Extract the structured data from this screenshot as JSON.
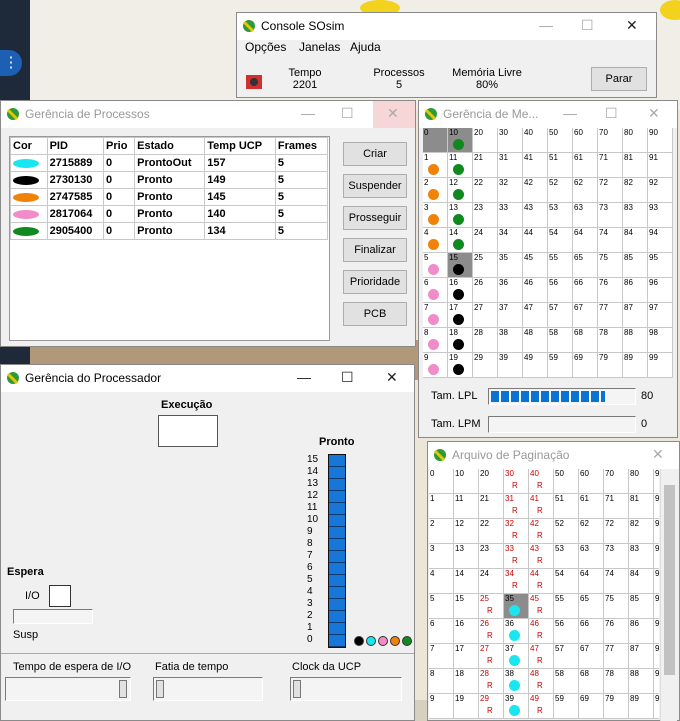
{
  "console": {
    "title": "Console SOsim",
    "menu": [
      "Opções",
      "Janelas",
      "Ajuda"
    ],
    "stats": [
      {
        "label": "Tempo",
        "value": "2201"
      },
      {
        "label": "Processos",
        "value": "5"
      },
      {
        "label": "Memória Livre",
        "value": "80%"
      }
    ],
    "stop_label": "Parar"
  },
  "processes": {
    "title": "Gerência de Processos",
    "columns": [
      "Cor",
      "PID",
      "Prio",
      "Estado",
      "Temp UCP",
      "Frames"
    ],
    "rows": [
      {
        "color": "#18e6f0",
        "pid": "2715889",
        "prio": "0",
        "state": "ProntoOut",
        "cpu": "157",
        "frames": "5"
      },
      {
        "color": "#000000",
        "pid": "2730130",
        "prio": "0",
        "state": "Pronto",
        "cpu": "149",
        "frames": "5"
      },
      {
        "color": "#f0820a",
        "pid": "2747585",
        "prio": "0",
        "state": "Pronto",
        "cpu": "145",
        "frames": "5"
      },
      {
        "color": "#f08cc8",
        "pid": "2817064",
        "prio": "0",
        "state": "Pronto",
        "cpu": "140",
        "frames": "5"
      },
      {
        "color": "#0f8a1e",
        "pid": "2905400",
        "prio": "0",
        "state": "Pronto",
        "cpu": "134",
        "frames": "5"
      }
    ],
    "buttons": [
      "Criar",
      "Suspender",
      "Prosseguir",
      "Finalizar",
      "Prioridade",
      "PCB"
    ]
  },
  "memory": {
    "title": "Gerência de Me...",
    "lpl_label": "Tam. LPL",
    "lpl_value": "80",
    "lpl_fill": 0.8,
    "lpm_label": "Tam. LPM",
    "lpm_value": "0",
    "col0": [
      "0",
      "1",
      "2",
      "3",
      "4",
      "5",
      "6",
      "7",
      "8",
      "9"
    ],
    "col0_colors": [
      "gray",
      "orange",
      "orange",
      "orange",
      "orange",
      "pink",
      "pink",
      "pink",
      "pink",
      "pink"
    ],
    "col1": [
      "10",
      "11",
      "12",
      "13",
      "14",
      "15",
      "16",
      "17",
      "18",
      "19"
    ],
    "col1_colors": [
      "green",
      "green",
      "green",
      "green",
      "green",
      "black",
      "black",
      "black",
      "black",
      "black"
    ],
    "cols": [
      [
        "20",
        "21",
        "22",
        "23",
        "24",
        "25",
        "26",
        "27",
        "28",
        "29"
      ],
      [
        "30",
        "31",
        "32",
        "33",
        "34",
        "35",
        "36",
        "37",
        "38",
        "39"
      ],
      [
        "40",
        "41",
        "42",
        "43",
        "44",
        "45",
        "46",
        "47",
        "48",
        "49"
      ],
      [
        "50",
        "51",
        "52",
        "53",
        "54",
        "55",
        "56",
        "57",
        "58",
        "59"
      ],
      [
        "60",
        "61",
        "62",
        "63",
        "64",
        "65",
        "66",
        "67",
        "68",
        "69"
      ],
      [
        "70",
        "71",
        "72",
        "73",
        "74",
        "75",
        "76",
        "77",
        "78",
        "79"
      ],
      [
        "80",
        "81",
        "82",
        "83",
        "84",
        "85",
        "86",
        "87",
        "88",
        "89"
      ],
      [
        "90",
        "91",
        "92",
        "93",
        "94",
        "95",
        "96",
        "97",
        "98",
        "99"
      ]
    ]
  },
  "paging": {
    "title": "Arquivo de Paginação",
    "cols": [
      [
        "0",
        "1",
        "2",
        "3",
        "4",
        "5",
        "6",
        "7",
        "8",
        "9"
      ],
      [
        "10",
        "11",
        "12",
        "13",
        "14",
        "15",
        "16",
        "17",
        "18",
        "19"
      ],
      [
        "20",
        "21",
        "22",
        "23",
        "24",
        "25",
        "26",
        "27",
        "28",
        "29"
      ],
      [
        "30",
        "31",
        "32",
        "33",
        "34",
        "35",
        "36",
        "37",
        "38",
        "39"
      ],
      [
        "40",
        "41",
        "42",
        "43",
        "44",
        "45",
        "46",
        "47",
        "48",
        "49"
      ],
      [
        "50",
        "51",
        "52",
        "53",
        "54",
        "55",
        "56",
        "57",
        "58",
        "59"
      ],
      [
        "60",
        "61",
        "62",
        "63",
        "64",
        "65",
        "66",
        "67",
        "68",
        "69"
      ],
      [
        "70",
        "71",
        "72",
        "73",
        "74",
        "75",
        "76",
        "77",
        "78",
        "79"
      ],
      [
        "80",
        "81",
        "82",
        "83",
        "84",
        "85",
        "86",
        "87",
        "88",
        "89"
      ],
      [
        "9",
        "9",
        "9",
        "9",
        "9",
        "9",
        "9",
        "9",
        "9",
        "9"
      ]
    ],
    "r_mark": "R"
  },
  "processor": {
    "title": "Gerência do Processador",
    "exec_label": "Execução",
    "ready_label": "Pronto",
    "queue_numbers": [
      "15",
      "14",
      "13",
      "12",
      "11",
      "10",
      "9",
      "8",
      "7",
      "6",
      "5",
      "4",
      "3",
      "2",
      "1",
      "0"
    ],
    "wait_label": "Espera",
    "io_label": "I/O",
    "susp_label": "Susp",
    "slider_labels": [
      "Tempo de espera de I/O",
      "Fatia de tempo",
      "Clock da UCP"
    ],
    "queue_colors": [
      "#000000",
      "#18e6f0",
      "#f08cc8",
      "#f0820a",
      "#0f8a1e"
    ]
  },
  "colors": {
    "orange": "#f0820a",
    "green": "#0f8a1e",
    "pink": "#f08cc8",
    "black": "#000000",
    "cyan": "#18e6f0",
    "progress": "#0a72d2"
  }
}
